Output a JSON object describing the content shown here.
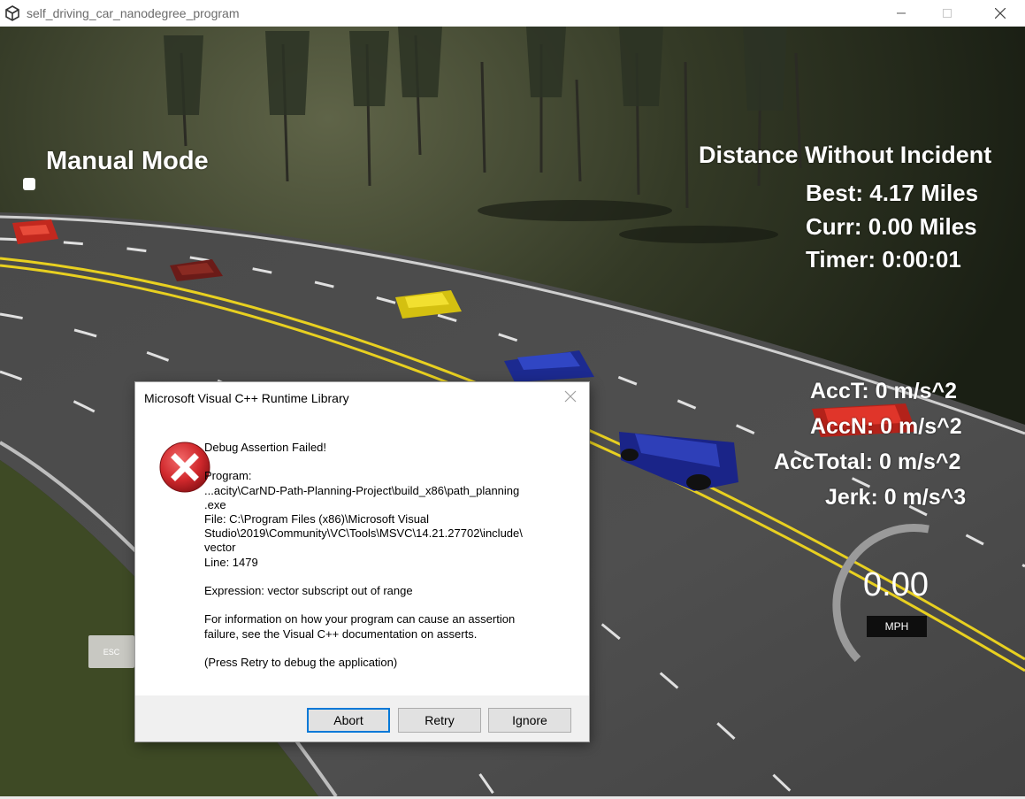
{
  "window": {
    "title": "self_driving_car_nanodegree_program",
    "icon": "unity-logo-icon",
    "controls": [
      "minimize-icon",
      "maximize-icon",
      "close-icon"
    ]
  },
  "hud": {
    "manual_mode_label": "Manual Mode",
    "distance_title": "Distance Without Incident",
    "best": "Best: 4.17 Miles",
    "curr": "Curr: 0.00 Miles",
    "timer": "Timer: 0:00:01",
    "acc_t": "AccT: 0 m/s^2",
    "acc_n": "AccN: 0 m/s^2",
    "acc_total": "AccTotal: 0 m/s^2",
    "jerk": "Jerk: 0 m/s^3",
    "speed": "0.00",
    "speed_unit": "MPH",
    "esc_label": "ESC"
  },
  "dialog": {
    "title": "Microsoft Visual C++ Runtime Library",
    "icon": "error-icon",
    "heading": "Debug Assertion Failed!",
    "program_label": "Program:",
    "program_path_1": "...acity\\CarND-Path-Planning-Project\\build_x86\\path_planning",
    "program_path_2": ".exe",
    "file_1": "File: C:\\Program Files (x86)\\Microsoft Visual",
    "file_2": "Studio\\2019\\Community\\VC\\Tools\\MSVC\\14.21.27702\\include\\",
    "file_3": "vector",
    "line": "Line: 1479",
    "expression": "Expression: vector subscript out of range",
    "info_1": "For information on how your program can cause an assertion",
    "info_2": "failure, see the Visual C++ documentation on asserts.",
    "hint": "(Press Retry to debug the application)",
    "buttons": {
      "abort": "Abort",
      "retry": "Retry",
      "ignore": "Ignore"
    }
  },
  "colors": {
    "dialog_focus": "#0078d7",
    "lane_yellow": "#e8d020",
    "error_red": "#d0282c"
  }
}
